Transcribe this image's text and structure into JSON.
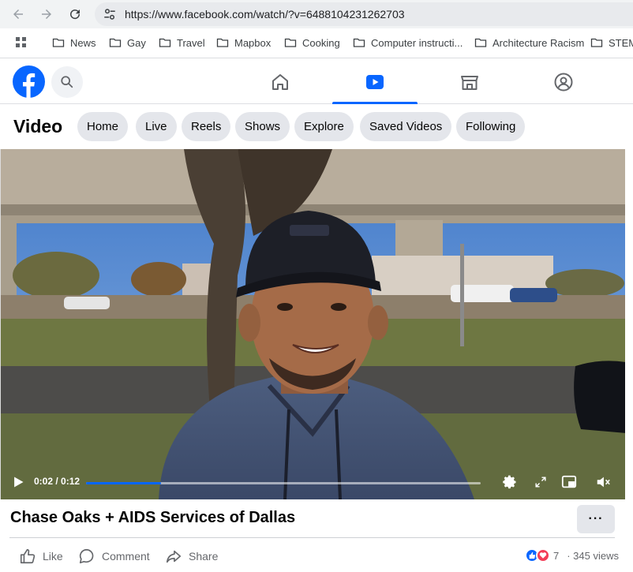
{
  "browser": {
    "url": "https://www.facebook.com/watch/?v=6488104231262703",
    "bookmarks": [
      "News",
      "Gay",
      "Travel",
      "Mapbox",
      "Cooking",
      "Computer instructi...",
      "Architecture Racism",
      "STEM"
    ]
  },
  "fb_nav": {
    "tabs": [
      "home",
      "watch",
      "marketplace",
      "groups"
    ],
    "active_tab": "watch"
  },
  "video_section": {
    "title": "Video",
    "pills": [
      "Home",
      "Live",
      "Reels",
      "Shows",
      "Explore",
      "Saved Videos",
      "Following"
    ]
  },
  "player": {
    "time": "0:02 / 0:12",
    "progress": 0.19
  },
  "post": {
    "title": "Chase Oaks + AIDS Services of Dallas",
    "more_label": "···",
    "actions": [
      "Like",
      "Comment",
      "Share"
    ],
    "reaction_count": "7",
    "views": "· 345 views"
  },
  "colors": {
    "brand": "#0866ff",
    "pill_bg": "#e4e6eb"
  }
}
